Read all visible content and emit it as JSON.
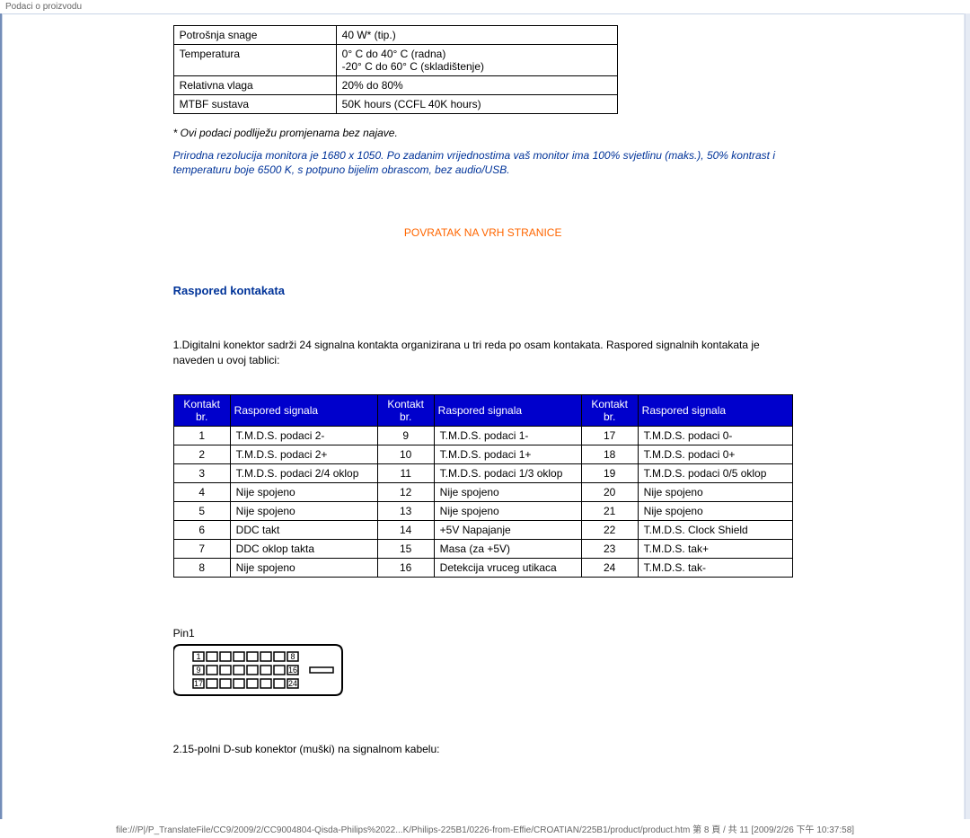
{
  "header_label": "Podaci o proizvodu",
  "spec_table": [
    {
      "k": "Potrošnja snage",
      "v": "40 W* (tip.)"
    },
    {
      "k": "Temperatura",
      "v": "0° C do 40° C (radna)\n-20° C do 60° C (skladištenje)"
    },
    {
      "k": "Relativna vlaga",
      "v": "20% do 80%"
    },
    {
      "k": "MTBF sustava",
      "v": "50K hours (CCFL 40K hours)"
    }
  ],
  "note1": "* Ovi podaci podliježu promjenama bez najave.",
  "note2": "Prirodna rezolucija monitora je 1680 x 1050. Po zadanim vrijednostima vaš monitor ima 100% svjetlinu (maks.), 50% kontrast i temperaturu boje 6500 K, s potpuno bijelim obrascom, bez audio/USB.",
  "return_link": "POVRATAK NA VRH STRANICE",
  "section_heading": "Raspored kontakata",
  "intro_text": "1.Digitalni konektor sadrži 24 signalna kontakta organizirana u tri reda po osam kontakata. Raspored signalnih kontakata je naveden u ovoj tablici:",
  "pin_headers": {
    "num": "Kontakt br.",
    "sig": "Raspored signala"
  },
  "pins_col1": [
    {
      "n": "1",
      "s": "T.M.D.S. podaci 2-"
    },
    {
      "n": "2",
      "s": "T.M.D.S. podaci 2+"
    },
    {
      "n": "3",
      "s": "T.M.D.S. podaci 2/4 oklop"
    },
    {
      "n": "4",
      "s": "Nije spojeno"
    },
    {
      "n": "5",
      "s": "Nije spojeno"
    },
    {
      "n": "6",
      "s": "DDC takt"
    },
    {
      "n": "7",
      "s": "DDC oklop takta"
    },
    {
      "n": "8",
      "s": "Nije spojeno"
    }
  ],
  "pins_col2": [
    {
      "n": "9",
      "s": "T.M.D.S. podaci 1-"
    },
    {
      "n": "10",
      "s": "T.M.D.S. podaci 1+"
    },
    {
      "n": "11",
      "s": "T.M.D.S. podaci 1/3 oklop"
    },
    {
      "n": "12",
      "s": "Nije spojeno"
    },
    {
      "n": "13",
      "s": "Nije spojeno"
    },
    {
      "n": "14",
      "s": "+5V Napajanje"
    },
    {
      "n": "15",
      "s": "Masa (za +5V)"
    },
    {
      "n": "16",
      "s": "Detekcija vruceg utikaca"
    }
  ],
  "pins_col3": [
    {
      "n": "17",
      "s": "T.M.D.S. podaci 0-"
    },
    {
      "n": "18",
      "s": "T.M.D.S. podaci 0+"
    },
    {
      "n": "19",
      "s": "T.M.D.S. podaci 0/5 oklop"
    },
    {
      "n": "20",
      "s": "Nije spojeno"
    },
    {
      "n": "21",
      "s": "Nije spojeno"
    },
    {
      "n": "22",
      "s": "T.M.D.S. Clock Shield"
    },
    {
      "n": "23",
      "s": "T.M.D.S. tak+"
    },
    {
      "n": "24",
      "s": "T.M.D.S. tak-"
    }
  ],
  "pin1_label": "Pin1",
  "connector_numbers": {
    "tl": "1",
    "tr": "8",
    "ml": "9",
    "mr": "16",
    "bl": "17",
    "br": "24"
  },
  "dsub_text": "2.15-polni D-sub konektor (muški) na signalnom kabelu:",
  "footer": "file:///P|/P_TranslateFile/CC9/2009/2/CC9004804-Qisda-Philips%2022...K/Philips-225B1/0226-from-Effie/CROATIAN/225B1/product/product.htm 第 8 頁 / 共 11  [2009/2/26 下午 10:37:58]"
}
